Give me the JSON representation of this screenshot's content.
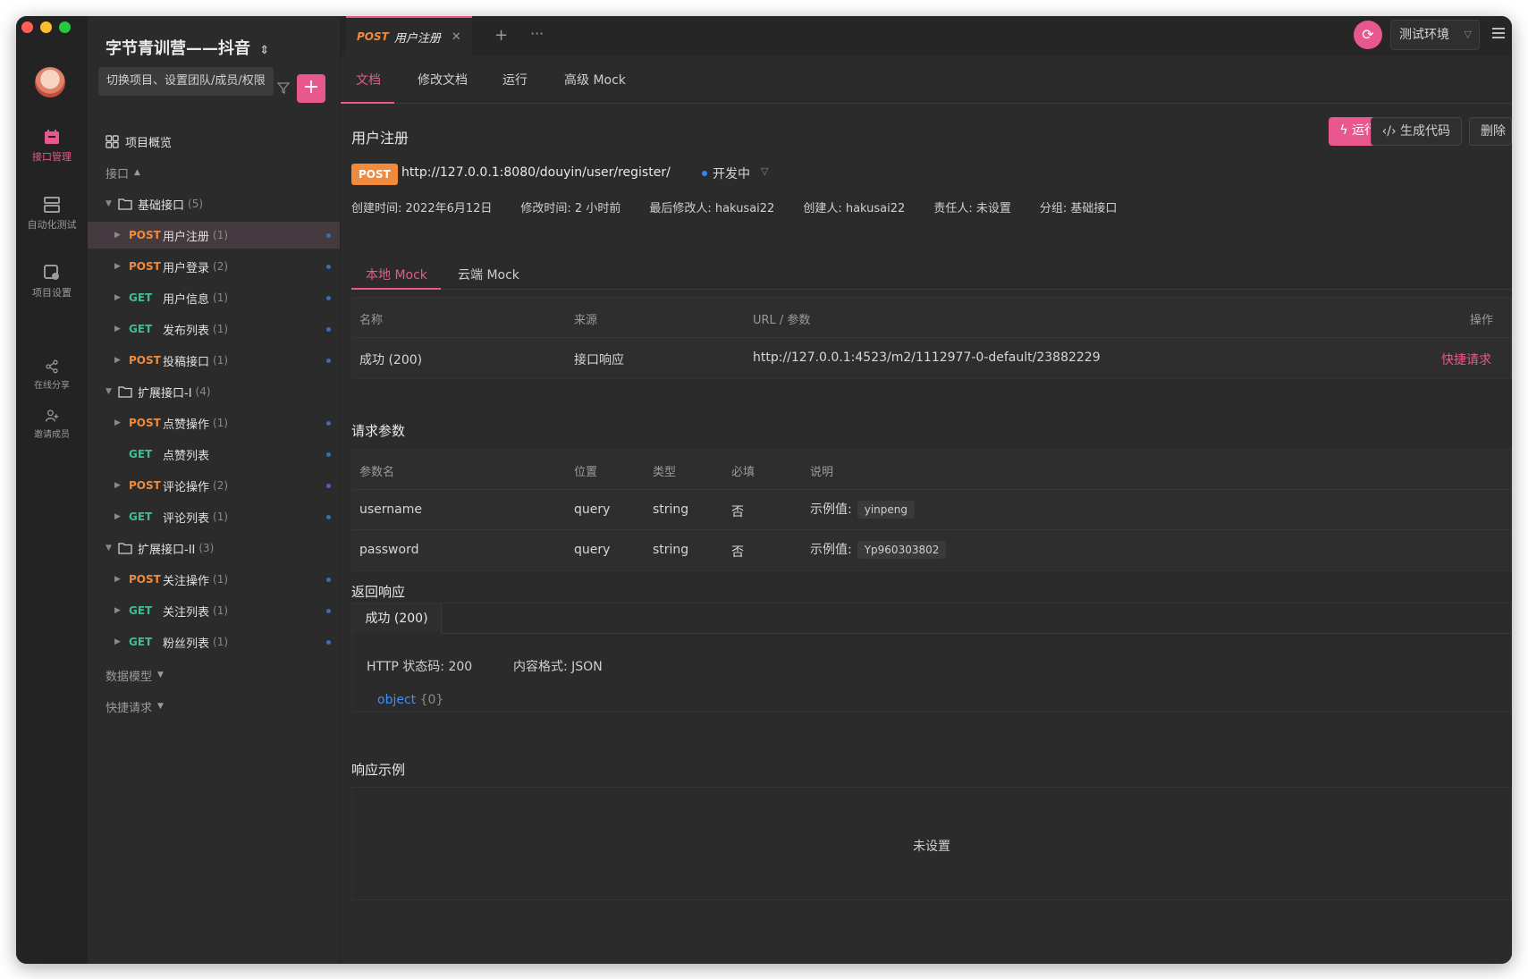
{
  "window_controls": {
    "close_color": "#ff5f57",
    "minimize_color": "#febc2e",
    "maximize_color": "#28c840"
  },
  "accent_color": "#e8588f",
  "rail": {
    "items": [
      {
        "label": "接口管理",
        "icon": "api-manage-icon",
        "active": true
      },
      {
        "label": "自动化测试",
        "icon": "automation-test-icon",
        "active": false
      },
      {
        "label": "项目设置",
        "icon": "project-settings-icon",
        "active": false
      },
      {
        "label": "在线分享",
        "icon": "share-icon",
        "active": false
      },
      {
        "label": "邀请成员",
        "icon": "invite-member-icon",
        "active": false
      }
    ]
  },
  "sidebar": {
    "project_title": "字节青训营——抖音",
    "tooltip": "切换项目、设置团队/成员/权限",
    "add_label": "+",
    "overview": "项目概览",
    "api_section": "接口",
    "groups": [
      {
        "name": "基础接口",
        "count": "(5)",
        "items": [
          {
            "method": "POST",
            "name": "用户注册",
            "count": "(1)"
          },
          {
            "method": "POST",
            "name": "用户登录",
            "count": "(2)"
          },
          {
            "method": "GET",
            "name": "用户信息",
            "count": "(1)"
          },
          {
            "method": "GET",
            "name": "发布列表",
            "count": "(1)"
          },
          {
            "method": "POST",
            "name": "投稿接口",
            "count": "(1)"
          }
        ]
      },
      {
        "name": "扩展接口-I",
        "count": "(4)",
        "items": [
          {
            "method": "POST",
            "name": "点赞操作",
            "count": "(1)"
          },
          {
            "method": "GET",
            "name": "点赞列表",
            "count": ""
          },
          {
            "method": "POST",
            "name": "评论操作",
            "count": "(2)"
          },
          {
            "method": "GET",
            "name": "评论列表",
            "count": "(1)"
          }
        ]
      },
      {
        "name": "扩展接口-II",
        "count": "(3)",
        "items": [
          {
            "method": "POST",
            "name": "关注操作",
            "count": "(1)"
          },
          {
            "method": "GET",
            "name": "关注列表",
            "count": "(1)"
          },
          {
            "method": "GET",
            "name": "粉丝列表",
            "count": "(1)"
          }
        ]
      }
    ],
    "data_model": "数据模型",
    "quick_request": "快捷请求"
  },
  "topbar": {
    "tab_method": "POST",
    "tab_title": "用户注册",
    "close": "✕",
    "plus": "+",
    "more": "···",
    "env": "测试环境"
  },
  "doc_tabs": [
    "文档",
    "修改文档",
    "运行",
    "高级 Mock"
  ],
  "api": {
    "title": "用户注册",
    "run": "运行",
    "gen_code": "生成代码",
    "delete": "删除",
    "method": "POST",
    "url": "http://127.0.0.1:8080/douyin/user/register/",
    "status": "开发中",
    "meta": [
      "创建时间: 2022年6月12日",
      "修改时间: 2 小时前",
      "最后修改人: hakusai22",
      "创建人: hakusai22",
      "责任人: 未设置",
      "分组: 基础接口"
    ]
  },
  "mock": {
    "tabs": [
      "本地 Mock",
      "云端 Mock"
    ],
    "headers": {
      "name": "名称",
      "source": "来源",
      "url": "URL / 参数",
      "action": "操作"
    },
    "row": {
      "name": "成功 (200)",
      "source": "接口响应",
      "url": "http://127.0.0.1:4523/m2/1112977-0-default/23882229",
      "action": "快捷请求"
    }
  },
  "params": {
    "title": "请求参数",
    "headers": {
      "name": "参数名",
      "position": "位置",
      "type": "类型",
      "required": "必填",
      "desc": "说明"
    },
    "rows": [
      {
        "name": "username",
        "position": "query",
        "type": "string",
        "required": "否",
        "desc_label": "示例值:",
        "example": "yinpeng"
      },
      {
        "name": "password",
        "position": "query",
        "type": "string",
        "required": "否",
        "desc_label": "示例值:",
        "example": "Yp960303802"
      }
    ]
  },
  "response": {
    "title": "返回响应",
    "tab": "成功 (200)",
    "http_status": "HTTP 状态码: 200",
    "content_type": "内容格式: JSON",
    "object": "object",
    "object_count": "{0}"
  },
  "example": {
    "title": "响应示例",
    "empty": "未设置"
  }
}
